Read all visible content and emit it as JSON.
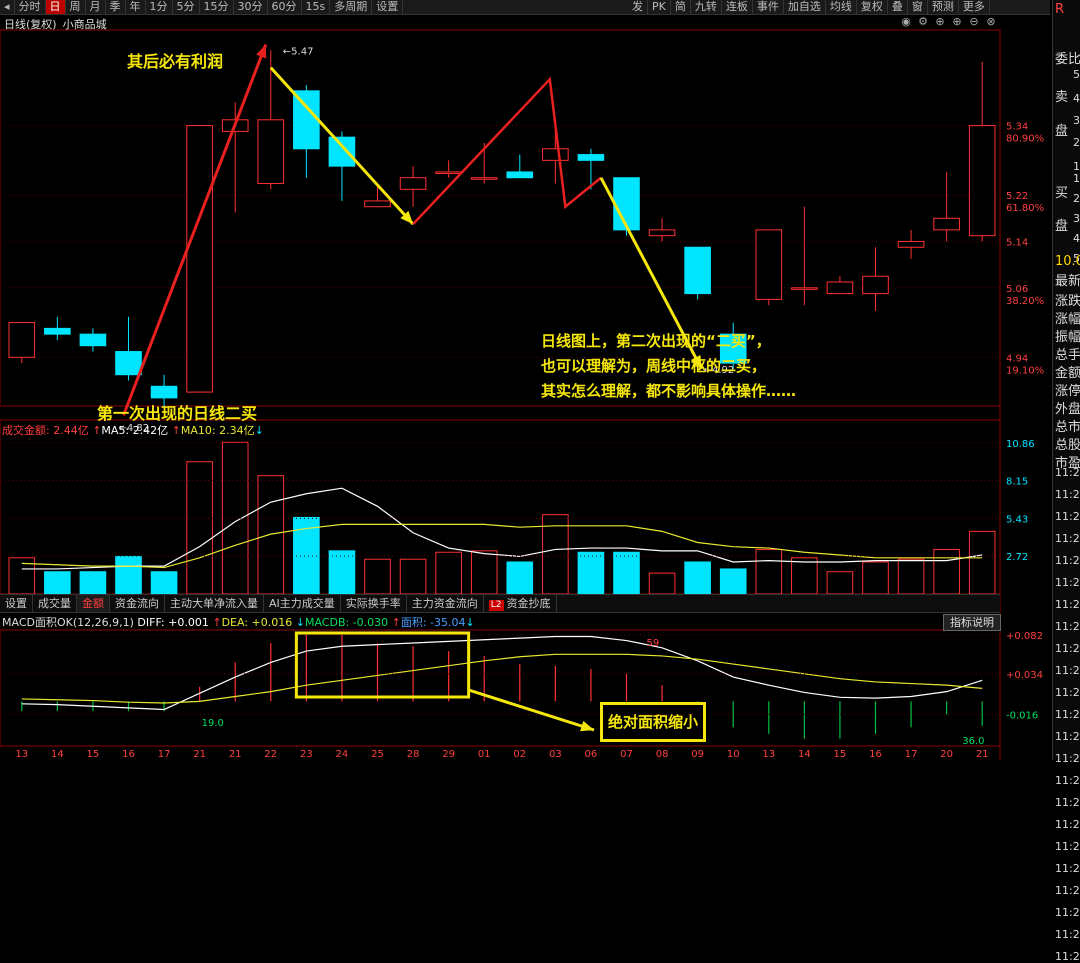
{
  "toolbar": {
    "items": [
      "分时",
      "日",
      "周",
      "月",
      "季",
      "年",
      "1分",
      "5分",
      "15分",
      "30分",
      "60分",
      "15s",
      "多周期",
      "设置"
    ],
    "active_index": 1,
    "right_items": [
      "发",
      "PK",
      "简",
      "九转",
      "连板",
      "事件",
      "加自选",
      "均线",
      "复权",
      "叠",
      "窗",
      "预测",
      "更多"
    ]
  },
  "chart_title": "日线(复权)",
  "stock_name": "小商品城",
  "right_panel": [
    "委比",
    "卖",
    "盘",
    "买",
    "盘",
    "最新",
    "涨跌",
    "涨幅",
    "振幅",
    "总手",
    "金额",
    "涨停",
    "外盘",
    "总市",
    "总股",
    "市盈"
  ],
  "right_panel_value": "10.0",
  "right_panel_times": [
    "11:2",
    "11:2",
    "11:2",
    "11:2",
    "11:2",
    "11:2",
    "11:2",
    "11:2",
    "11:2",
    "11:2",
    "11:2",
    "11:2",
    "11:2",
    "11:2",
    "11:2",
    "11:2",
    "11:2",
    "11:2",
    "11:2",
    "11:2",
    "11:2",
    "11:2",
    "11:2"
  ],
  "right_panel_nums": [
    "5",
    "4",
    "3",
    "2",
    "1",
    "1",
    "2",
    "3",
    "4",
    "5"
  ],
  "annotations": {
    "top": "其后必有利润",
    "first_buy": "第一次出现的日线二买",
    "second_buy_line1": "日线图上，第二次出现的“二买”，",
    "second_buy_line2": "也可以理解为，周线中枢的二买，",
    "second_buy_line3": "其实怎么理解，都不影响具体操作……",
    "macd_box": "绝对面积缩小"
  },
  "volume_header": {
    "label": "成交金额: 2.44亿",
    "ma5": "MA5: 2.42亿",
    "ma10": "MA10: 2.34亿"
  },
  "tabs": [
    "设置",
    "成交量",
    "金额",
    "资金流向",
    "主动大单净流入量",
    "AI主力成交量",
    "实际换手率",
    "主力资金流向",
    "资金抄底"
  ],
  "tabs_active_index": 2,
  "tab_badge": "L2",
  "macd_header": {
    "name": "MACD面积OK(12,26,9,1)",
    "diff": "DIFF: +0.001",
    "dea": "DEA: +0.016",
    "macdb": "MACDB: -0.030",
    "area": "面积: -35.04"
  },
  "macd_help": "指标说明",
  "macd_labels": {
    "a": "19.0",
    "b": "59",
    "c": "36.0"
  },
  "colors": {
    "up": "#ff3030",
    "down": "#00e5ff",
    "ma5": "#ffffff",
    "ma10": "#e8e830",
    "yellow_box": "#f5e60c",
    "arrow_red": "#e82020",
    "arrow_yellow": "#f5e60c"
  },
  "chart_data": {
    "type": "candlestick",
    "price_axis": {
      "ticks": [
        5.34,
        5.22,
        5.14,
        5.06,
        4.94
      ],
      "tick_labels": [
        "5.34",
        "5.22",
        "5.14",
        "5.06",
        "4.94"
      ],
      "pct_labels": [
        "80.90%",
        "61.80%",
        "38.20%",
        "19.10%"
      ],
      "ylim": [
        4.856,
        5.505
      ]
    },
    "max_label": "5.47",
    "min_label": "4.82",
    "low_label2": "4.92",
    "candles": [
      {
        "date": "13",
        "o": 4.94,
        "c": 5.0,
        "h": 5.0,
        "l": 4.93
      },
      {
        "date": "14",
        "o": 4.99,
        "c": 4.98,
        "h": 5.01,
        "l": 4.97
      },
      {
        "date": "15",
        "o": 4.98,
        "c": 4.96,
        "h": 4.99,
        "l": 4.95
      },
      {
        "date": "16",
        "o": 4.95,
        "c": 4.91,
        "h": 5.01,
        "l": 4.9
      },
      {
        "date": "17",
        "o": 4.89,
        "c": 4.87,
        "h": 4.91,
        "l": 4.85
      },
      {
        "date": "21",
        "o": 4.88,
        "c": 5.34,
        "h": 5.34,
        "l": 4.88
      },
      {
        "date": "21",
        "o": 5.33,
        "c": 5.35,
        "h": 5.38,
        "l": 5.19
      },
      {
        "date": "22",
        "o": 5.24,
        "c": 5.35,
        "h": 5.47,
        "l": 5.23
      },
      {
        "date": "23",
        "o": 5.4,
        "c": 5.3,
        "h": 5.41,
        "l": 5.25
      },
      {
        "date": "24",
        "o": 5.32,
        "c": 5.27,
        "h": 5.33,
        "l": 5.21
      },
      {
        "date": "25",
        "o": 5.2,
        "c": 5.21,
        "h": 5.24,
        "l": 5.2
      },
      {
        "date": "28",
        "o": 5.23,
        "c": 5.25,
        "h": 5.27,
        "l": 5.2
      },
      {
        "date": "29",
        "o": 5.26,
        "c": 5.26,
        "h": 5.28,
        "l": 5.25
      },
      {
        "date": "01",
        "o": 5.25,
        "c": 5.25,
        "h": 5.31,
        "l": 5.24
      },
      {
        "date": "02",
        "o": 5.26,
        "c": 5.25,
        "h": 5.29,
        "l": 5.25
      },
      {
        "date": "03",
        "o": 5.28,
        "c": 5.3,
        "h": 5.33,
        "l": 5.24
      },
      {
        "date": "06",
        "o": 5.29,
        "c": 5.28,
        "h": 5.3,
        "l": 5.23
      },
      {
        "date": "07",
        "o": 5.25,
        "c": 5.16,
        "h": 5.25,
        "l": 5.15
      },
      {
        "date": "08",
        "o": 5.15,
        "c": 5.16,
        "h": 5.18,
        "l": 5.14
      },
      {
        "date": "09",
        "o": 5.13,
        "c": 5.05,
        "h": 5.13,
        "l": 5.04
      },
      {
        "date": "10",
        "o": 4.98,
        "c": 4.93,
        "h": 5.0,
        "l": 4.92
      },
      {
        "date": "13",
        "o": 5.04,
        "c": 5.16,
        "h": 5.16,
        "l": 5.03
      },
      {
        "date": "14",
        "o": 5.06,
        "c": 5.06,
        "h": 5.2,
        "l": 5.03
      },
      {
        "date": "15",
        "o": 5.05,
        "c": 5.07,
        "h": 5.08,
        "l": 5.05
      },
      {
        "date": "16",
        "o": 5.05,
        "c": 5.08,
        "h": 5.13,
        "l": 5.02
      },
      {
        "date": "17",
        "o": 5.13,
        "c": 5.14,
        "h": 5.16,
        "l": 5.11
      },
      {
        "date": "20",
        "o": 5.16,
        "c": 5.18,
        "h": 5.26,
        "l": 5.14
      },
      {
        "date": "21",
        "o": 5.15,
        "c": 5.34,
        "h": 5.45,
        "l": 5.14
      }
    ],
    "volume": {
      "ticks": [
        "10.86",
        "8.15",
        "5.43",
        "2.72"
      ],
      "ylim": [
        0,
        12.5
      ],
      "values": [
        2.6,
        1.6,
        1.6,
        2.7,
        1.6,
        9.5,
        10.9,
        8.5,
        5.5,
        3.1,
        2.5,
        2.5,
        3.0,
        3.1,
        2.3,
        5.7,
        3.0,
        3.0,
        1.5,
        2.3,
        1.8,
        3.2,
        2.6,
        1.6,
        2.3,
        2.5,
        3.2,
        4.5
      ],
      "ma5": [
        1.8,
        1.8,
        1.9,
        2.0,
        2.0,
        3.4,
        5.2,
        6.6,
        7.2,
        7.6,
        6.3,
        4.4,
        3.3,
        2.9,
        2.7,
        3.2,
        3.3,
        3.3,
        3.1,
        3.1,
        2.3,
        2.4,
        2.3,
        2.3,
        2.4,
        2.4,
        2.4,
        2.8
      ],
      "ma10": [
        2.2,
        2.1,
        2.0,
        2.0,
        1.9,
        2.6,
        3.5,
        4.3,
        4.7,
        5.0,
        5.0,
        5.0,
        5.0,
        5.0,
        4.8,
        4.9,
        4.9,
        4.9,
        4.5,
        3.7,
        3.4,
        3.3,
        3.0,
        2.8,
        2.6,
        2.6,
        2.6,
        2.6
      ]
    },
    "macd": {
      "ticks": [
        "+0.082",
        "+0.034",
        "-0.016"
      ],
      "ylim": [
        -0.055,
        0.088
      ],
      "diff": [
        -0.003,
        -0.004,
        -0.006,
        -0.008,
        -0.01,
        0.01,
        0.03,
        0.048,
        0.062,
        0.068,
        0.07,
        0.072,
        0.074,
        0.076,
        0.078,
        0.08,
        0.08,
        0.075,
        0.066,
        0.05,
        0.03,
        0.02,
        0.011,
        0.005,
        0.004,
        0.006,
        0.012,
        0.026
      ],
      "dea": [
        0.003,
        0.002,
        0.001,
        -0.001,
        -0.002,
        0.0,
        0.006,
        0.012,
        0.02,
        0.026,
        0.032,
        0.038,
        0.044,
        0.05,
        0.055,
        0.058,
        0.058,
        0.058,
        0.056,
        0.052,
        0.046,
        0.04,
        0.034,
        0.028,
        0.024,
        0.022,
        0.02,
        0.016
      ],
      "hist": [
        -0.012,
        -0.012,
        -0.012,
        -0.012,
        -0.012,
        0.018,
        0.048,
        0.072,
        0.082,
        0.082,
        0.072,
        0.068,
        0.062,
        0.056,
        0.046,
        0.044,
        0.04,
        0.034,
        0.02,
        -0.004,
        -0.032,
        -0.04,
        -0.046,
        -0.046,
        -0.04,
        -0.032,
        -0.016,
        -0.03
      ]
    }
  }
}
